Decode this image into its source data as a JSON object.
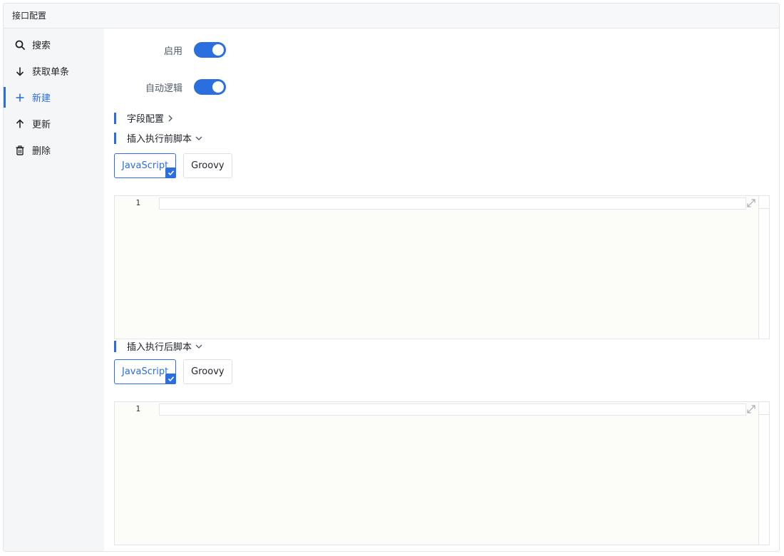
{
  "window": {
    "title": "接口配置"
  },
  "sidebar": {
    "items": [
      {
        "label": "搜索",
        "icon": "search-icon",
        "active": false
      },
      {
        "label": "获取单条",
        "icon": "arrow-down-icon",
        "active": false
      },
      {
        "label": "新建",
        "icon": "plus-icon",
        "active": true
      },
      {
        "label": "更新",
        "icon": "arrow-up-icon",
        "active": false
      },
      {
        "label": "删除",
        "icon": "trash-icon",
        "active": false
      }
    ]
  },
  "form": {
    "enable": {
      "label": "启用",
      "value": true
    },
    "auto_logic": {
      "label": "自动逻辑",
      "value": true
    }
  },
  "sections": {
    "field_config": {
      "title": "字段配置",
      "icon": "chevron-right-icon"
    },
    "before_script": {
      "title": "插入执行前脚本",
      "icon": "chevron-down-icon",
      "languages": [
        "JavaScript",
        "Groovy"
      ],
      "selected": "JavaScript",
      "editor": {
        "line_number": "1",
        "content": ""
      }
    },
    "after_script": {
      "title": "插入执行后脚本",
      "icon": "chevron-down-icon",
      "languages": [
        "JavaScript",
        "Groovy"
      ],
      "selected": "JavaScript",
      "editor": {
        "line_number": "1",
        "content": ""
      }
    }
  },
  "colors": {
    "accent": "#2b6ee0",
    "sidebar_bg": "#f5f6f7",
    "editor_bg": "#fcfcf8"
  }
}
